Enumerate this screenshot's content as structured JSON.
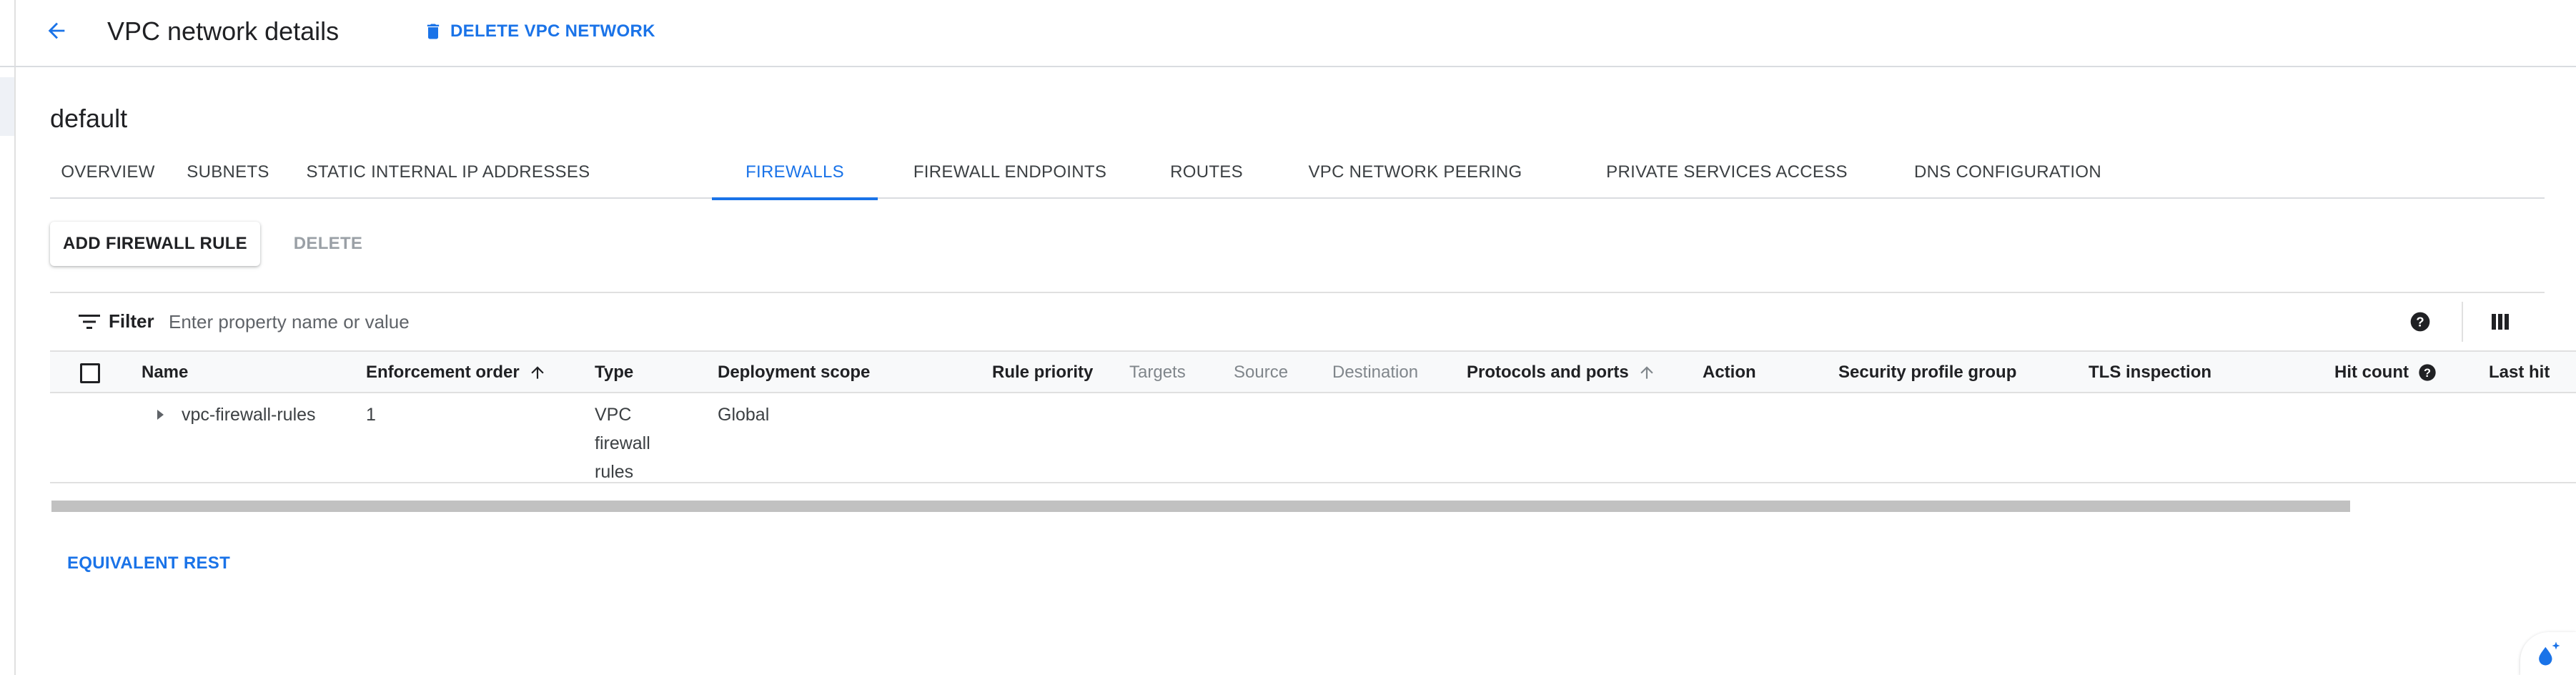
{
  "header": {
    "title": "VPC network details",
    "delete_label": "DELETE VPC NETWORK"
  },
  "network": {
    "name": "default"
  },
  "tabs": [
    {
      "label": "OVERVIEW",
      "active": false
    },
    {
      "label": "SUBNETS",
      "active": false
    },
    {
      "label": "STATIC INTERNAL IP ADDRESSES",
      "active": false
    },
    {
      "label": "FIREWALLS",
      "active": true
    },
    {
      "label": "FIREWALL ENDPOINTS",
      "active": false
    },
    {
      "label": "ROUTES",
      "active": false
    },
    {
      "label": "VPC NETWORK PEERING",
      "active": false
    },
    {
      "label": "PRIVATE SERVICES ACCESS",
      "active": false
    },
    {
      "label": "DNS CONFIGURATION",
      "active": false
    }
  ],
  "actions": {
    "add_label": "ADD FIREWALL RULE",
    "delete_label": "DELETE"
  },
  "filter": {
    "label": "Filter",
    "placeholder": "Enter property name or value"
  },
  "table": {
    "columns": {
      "name": "Name",
      "enforcement_order": "Enforcement order",
      "type": "Type",
      "deployment_scope": "Deployment scope",
      "rule_priority": "Rule priority",
      "targets": "Targets",
      "source": "Source",
      "destination": "Destination",
      "protocols_ports": "Protocols and ports",
      "action": "Action",
      "security_profile_group": "Security profile group",
      "tls_inspection": "TLS inspection",
      "hit_count": "Hit count",
      "last_hit": "Last hit"
    },
    "rows": [
      {
        "name": "vpc-firewall-rules",
        "enforcement_order": "1",
        "type_lines": [
          "VPC",
          "firewall",
          "rules"
        ],
        "deployment_scope": "Global"
      }
    ]
  },
  "footer": {
    "equivalent_rest": "EQUIVALENT REST"
  },
  "colors": {
    "accent": "#1a73e8",
    "text": "#202124",
    "muted": "#80868b",
    "divider": "#e0e0e0"
  }
}
